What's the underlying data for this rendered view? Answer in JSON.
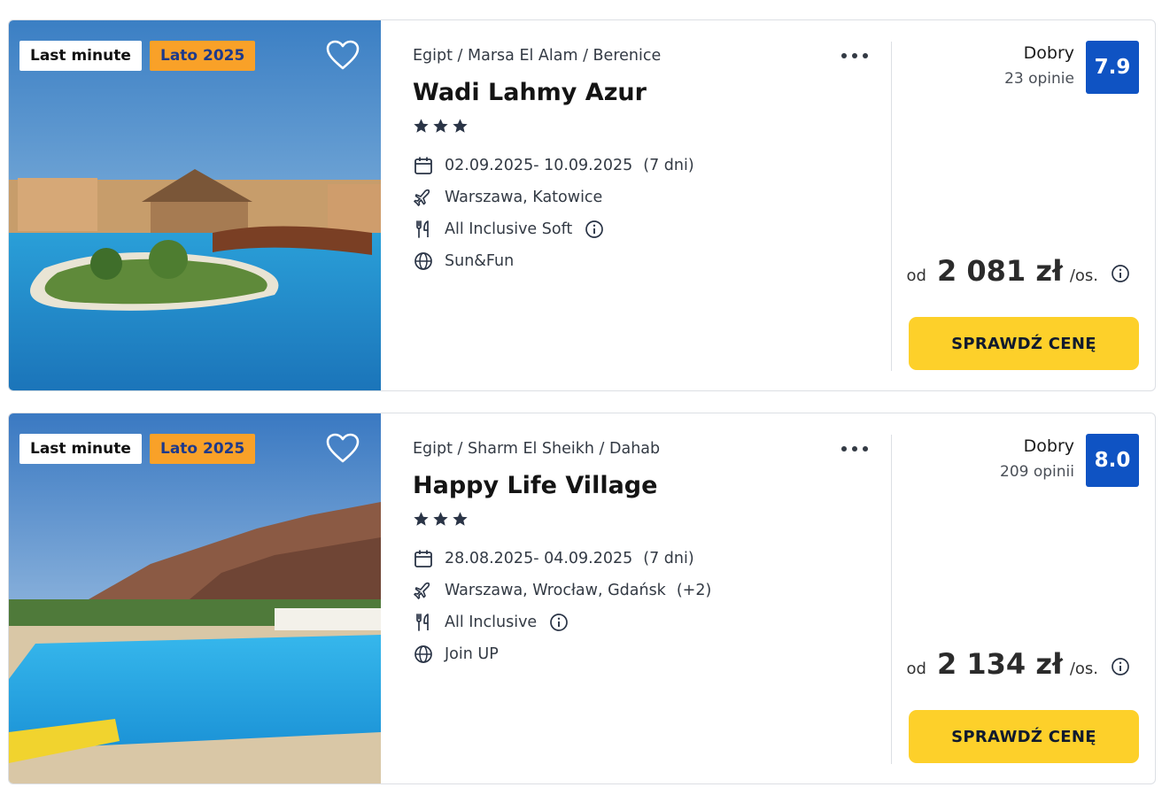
{
  "offers": [
    {
      "badges": [
        "Last minute",
        "Lato 2025"
      ],
      "location": "Egipt / Marsa El Alam / Berenice",
      "name": "Wadi Lahmy Azur",
      "stars": 3,
      "dates": "02.09.2025- 10.09.2025",
      "duration": "(7 dni)",
      "departures": "Warszawa, Katowice",
      "departures_extra": "",
      "board": "All Inclusive Soft",
      "concept": "Sun&Fun",
      "rating_label": "Dobry",
      "rating_count": "23 opinie",
      "rating": "7.9",
      "price_from": "od",
      "price": "2 081 zł",
      "price_per": "/os.",
      "cta": "SPRAWDŹ CENĘ"
    },
    {
      "badges": [
        "Last minute",
        "Lato 2025"
      ],
      "location": "Egipt / Sharm El Sheikh / Dahab",
      "name": "Happy Life Village",
      "stars": 3,
      "dates": "28.08.2025- 04.09.2025",
      "duration": "(7 dni)",
      "departures": "Warszawa, Wrocław, Gdańsk",
      "departures_extra": "(+2)",
      "board": "All Inclusive",
      "concept": "Join UP",
      "rating_label": "Dobry",
      "rating_count": "209 opinii",
      "rating": "8.0",
      "price_from": "od",
      "price": "2 134 zł",
      "price_per": "/os.",
      "cta": "SPRAWDŹ CENĘ"
    }
  ],
  "icons": {
    "favorite": "heart-outline-icon",
    "menu": "more-dots-icon",
    "star": "star-icon",
    "dates": "calendar-icon",
    "departures": "plane-icon",
    "board": "cutlery-icon",
    "concept": "globe-icon",
    "info": "info-circle-icon"
  },
  "colors": {
    "rating_badge": "#0f53c3",
    "cta": "#fdd02a",
    "season_badge": "#f9a128"
  }
}
